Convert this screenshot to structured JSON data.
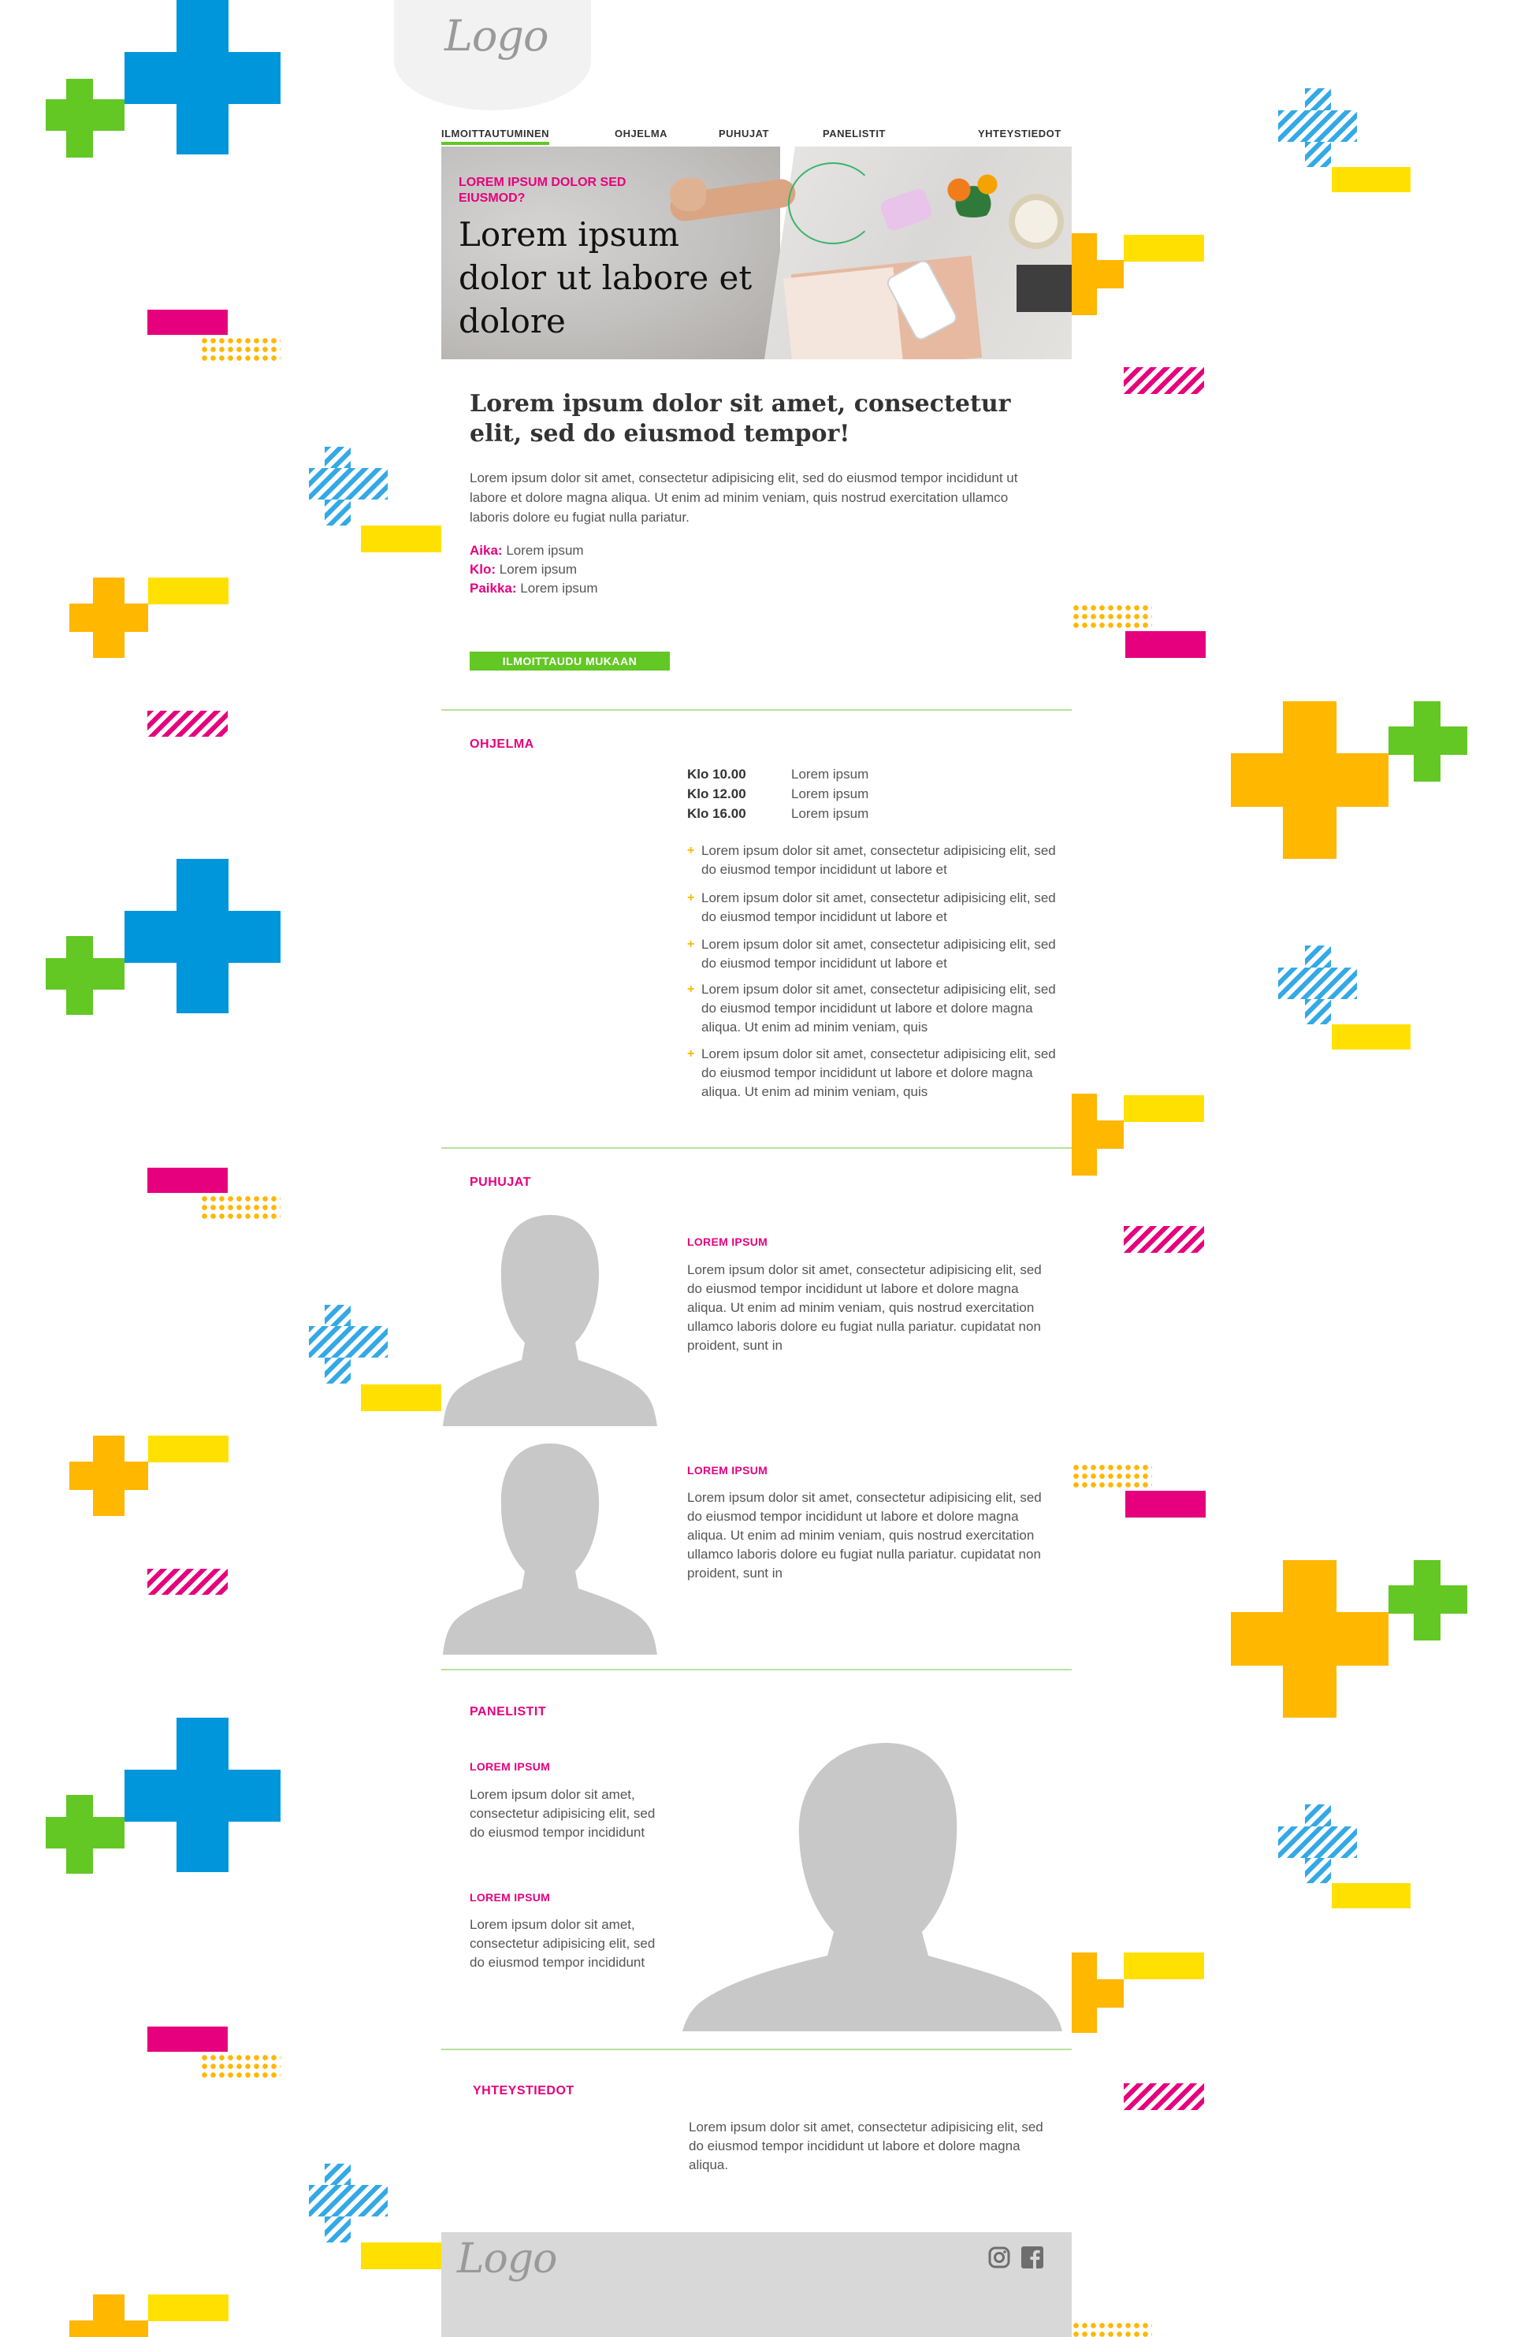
{
  "logo": {
    "text": "Logo"
  },
  "nav": {
    "items": [
      {
        "label": "ILMOITTAUTUMINEN"
      },
      {
        "label": "OHJELMA"
      },
      {
        "label": "PUHUJAT"
      },
      {
        "label": "PANELISTIT"
      },
      {
        "label": "YHTEYSTIEDOT"
      }
    ],
    "active_index": 0
  },
  "hero": {
    "kicker": "LOREM IPSUM DOLOR SED EIUSMOD?",
    "title": "Lorem ipsum dolor ut labore et dolore"
  },
  "intro": {
    "title": "Lorem ipsum dolor sit amet, consectetur elit, sed do eiusmod tempor!",
    "text": "Lorem ipsum dolor sit amet, consectetur adipisicing elit, sed do eiusmod tempor incididunt ut labore et dolore magna aliqua. Ut enim ad minim veniam, quis nostrud exercitation ullamco laboris dolore eu fugiat nulla pariatur.",
    "meta": [
      {
        "label": "Aika:",
        "value": "Lorem ipsum"
      },
      {
        "label": "Klo:",
        "value": "Lorem ipsum"
      },
      {
        "label": "Paikka:",
        "value": "Lorem ipsum"
      }
    ],
    "cta": "ILMOITTAUDU MUKAAN"
  },
  "program": {
    "title": "OHJELMA",
    "schedule": [
      {
        "time": "Klo 10.00",
        "text": "Lorem ipsum"
      },
      {
        "time": "Klo 12.00",
        "text": "Lorem ipsum"
      },
      {
        "time": "Klo 16.00",
        "text": "Lorem ipsum"
      }
    ],
    "bullets": [
      "Lorem ipsum dolor sit amet, consectetur adipisicing elit, sed do eiusmod tempor incididunt ut labore et",
      "Lorem ipsum dolor sit amet, consectetur adipisicing elit, sed do eiusmod tempor incididunt ut labore et",
      "Lorem ipsum dolor sit amet, consectetur adipisicing elit, sed do eiusmod tempor incididunt ut labore et",
      "Lorem ipsum dolor sit amet, consectetur adipisicing elit, sed do eiusmod tempor incididunt ut labore et dolore magna aliqua. Ut enim ad minim veniam, quis",
      "Lorem ipsum dolor sit amet, consectetur adipisicing elit, sed do eiusmod tempor incididunt ut labore et dolore magna aliqua. Ut enim ad minim veniam, quis"
    ]
  },
  "speakers": {
    "title": "PUHUJAT",
    "items": [
      {
        "name": "LOREM IPSUM",
        "text": "Lorem ipsum dolor sit amet, consectetur adipisicing elit, sed do eiusmod tempor incididunt ut labore et dolore magna aliqua. Ut enim ad minim veniam, quis nostrud exercitation ullamco laboris dolore eu fugiat nulla pariatur. cupidatat non proident, sunt in"
      },
      {
        "name": "LOREM IPSUM",
        "text": "Lorem ipsum dolor sit amet, consectetur adipisicing elit, sed do eiusmod tempor incididunt ut labore et dolore magna aliqua. Ut enim ad minim veniam, quis nostrud exercitation ullamco laboris dolore eu fugiat nulla pariatur. cupidatat non proident, sunt in"
      }
    ]
  },
  "panelists": {
    "title": "PANELISTIT",
    "items": [
      {
        "name": "LOREM IPSUM",
        "text": "Lorem ipsum dolor sit amet, consectetur adipisicing elit, sed do eiusmod tempor incididunt"
      },
      {
        "name": "LOREM IPSUM",
        "text": "Lorem ipsum dolor sit amet, consectetur adipisicing elit, sed do eiusmod tempor incididunt"
      }
    ]
  },
  "contact": {
    "title": "YHTEYSTIEDOT",
    "text": "Lorem ipsum dolor sit amet, consectetur adipisicing elit, sed do eiusmod tempor incididunt ut labore et dolore magna aliqua."
  },
  "footer": {
    "logo": "Logo",
    "social": [
      {
        "icon": "instagram-icon"
      },
      {
        "icon": "facebook-icon"
      }
    ]
  },
  "colors": {
    "accent_pink": "#e6007e",
    "accent_green": "#63c724",
    "accent_orange": "#ffb700",
    "accent_yellow": "#ffe000",
    "accent_blue": "#0096dc",
    "footer_bg": "#d8d8d8"
  }
}
